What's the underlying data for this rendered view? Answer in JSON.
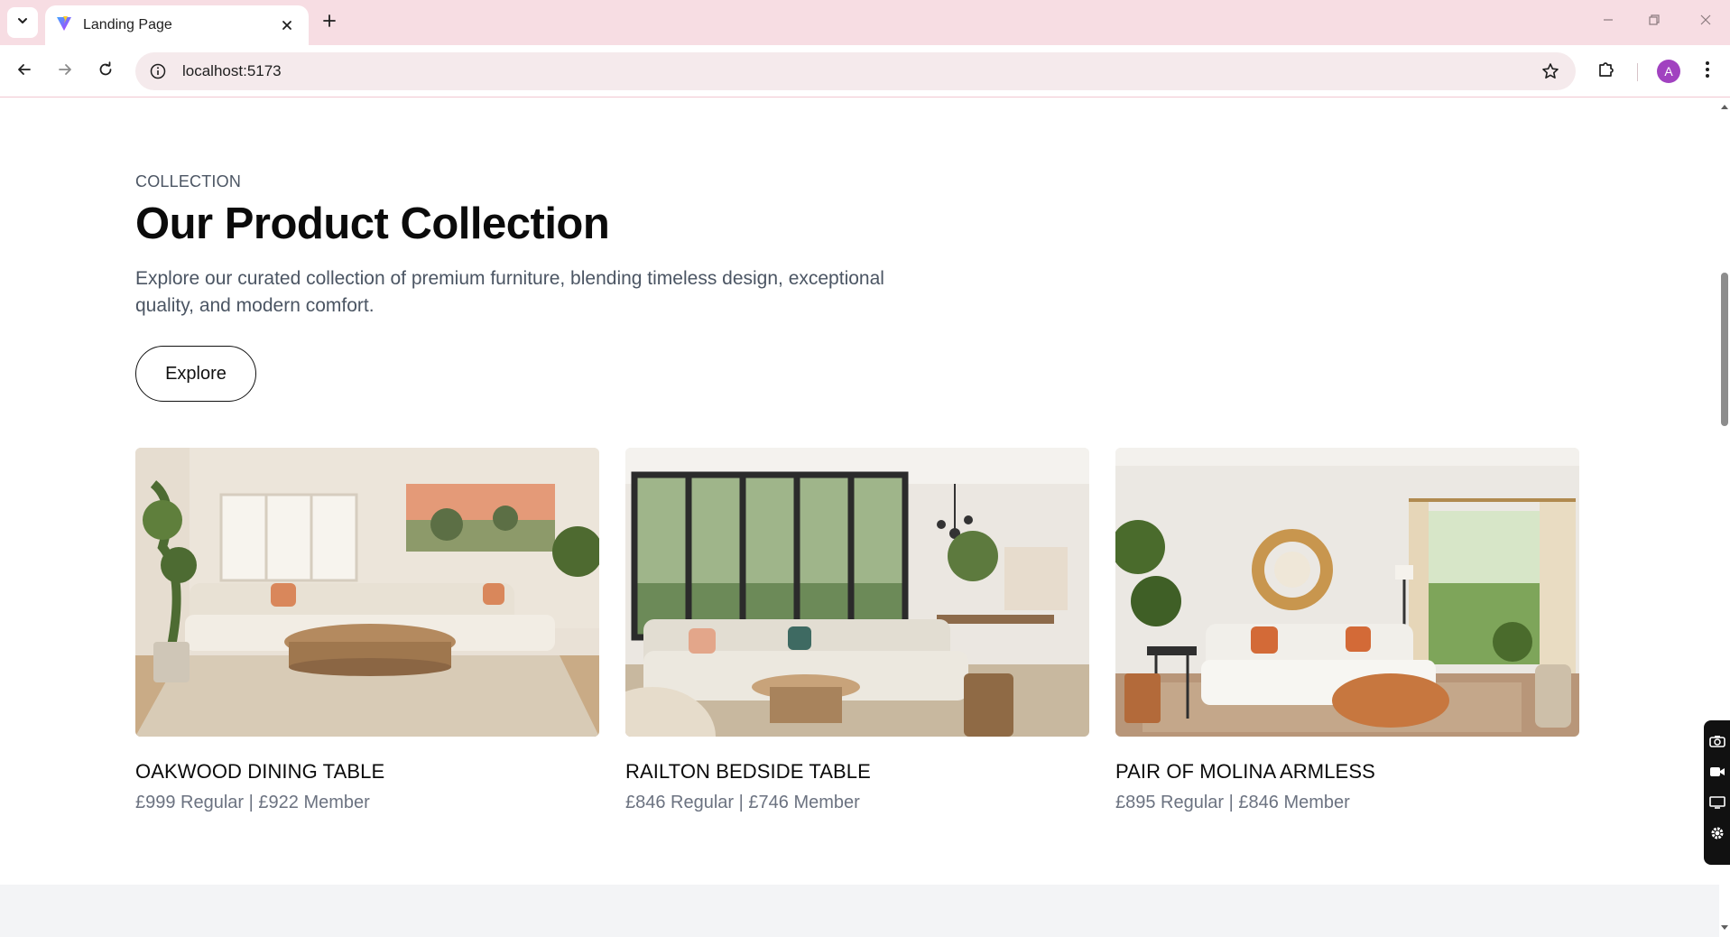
{
  "browser": {
    "tab_title": "Landing Page",
    "url": "localhost:5173",
    "profile_initial": "A",
    "accent": "#f7dde3"
  },
  "section": {
    "eyebrow": "COLLECTION",
    "heading": "Our Product Collection",
    "description": "Explore our curated collection of premium furniture, blending timeless design, exceptional quality, and modern comfort.",
    "cta_label": "Explore"
  },
  "products": [
    {
      "title": "OAKWOOD DINING TABLE",
      "price": "£999 Regular | £922 Member",
      "image": "living-room-photo"
    },
    {
      "title": "RAILTON BEDSIDE TABLE",
      "price": "£846 Regular | £746 Member",
      "image": "living-dining-room-photo"
    },
    {
      "title": "PAIR OF MOLINA ARMLESS",
      "price": "£895 Regular | £846 Member",
      "image": "sunlit-living-room-photo"
    }
  ],
  "icons": {
    "tab_menu": "chevron-down-icon",
    "favicon": "vite-logo-icon",
    "close": "close-icon",
    "new_tab": "plus-icon",
    "back": "arrow-left-icon",
    "forward": "arrow-right-icon",
    "reload": "reload-icon",
    "site_info": "info-icon",
    "bookmark": "star-icon",
    "extensions": "puzzle-icon",
    "menu": "kebab-menu-icon",
    "widget": [
      "camera-icon",
      "video-icon",
      "screen-icon",
      "gear-icon"
    ]
  }
}
